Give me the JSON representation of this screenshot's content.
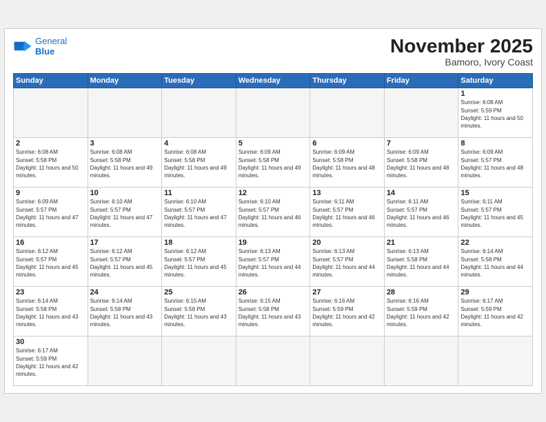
{
  "header": {
    "logo_line1": "General",
    "logo_line2": "Blue",
    "title": "November 2025",
    "subtitle": "Bamoro, Ivory Coast"
  },
  "weekdays": [
    "Sunday",
    "Monday",
    "Tuesday",
    "Wednesday",
    "Thursday",
    "Friday",
    "Saturday"
  ],
  "weeks": [
    [
      {
        "day": "",
        "empty": true
      },
      {
        "day": "",
        "empty": true
      },
      {
        "day": "",
        "empty": true
      },
      {
        "day": "",
        "empty": true
      },
      {
        "day": "",
        "empty": true
      },
      {
        "day": "",
        "empty": true
      },
      {
        "day": "1",
        "sunrise": "6:08 AM",
        "sunset": "5:59 PM",
        "daylight": "11 hours and 50 minutes."
      }
    ],
    [
      {
        "day": "2",
        "sunrise": "6:08 AM",
        "sunset": "5:58 PM",
        "daylight": "11 hours and 50 minutes."
      },
      {
        "day": "3",
        "sunrise": "6:08 AM",
        "sunset": "5:58 PM",
        "daylight": "11 hours and 49 minutes."
      },
      {
        "day": "4",
        "sunrise": "6:08 AM",
        "sunset": "5:58 PM",
        "daylight": "11 hours and 49 minutes."
      },
      {
        "day": "5",
        "sunrise": "6:09 AM",
        "sunset": "5:58 PM",
        "daylight": "11 hours and 49 minutes."
      },
      {
        "day": "6",
        "sunrise": "6:09 AM",
        "sunset": "5:58 PM",
        "daylight": "11 hours and 48 minutes."
      },
      {
        "day": "7",
        "sunrise": "6:09 AM",
        "sunset": "5:58 PM",
        "daylight": "11 hours and 48 minutes."
      },
      {
        "day": "8",
        "sunrise": "6:09 AM",
        "sunset": "5:57 PM",
        "daylight": "11 hours and 48 minutes."
      }
    ],
    [
      {
        "day": "9",
        "sunrise": "6:09 AM",
        "sunset": "5:57 PM",
        "daylight": "11 hours and 47 minutes."
      },
      {
        "day": "10",
        "sunrise": "6:10 AM",
        "sunset": "5:57 PM",
        "daylight": "11 hours and 47 minutes."
      },
      {
        "day": "11",
        "sunrise": "6:10 AM",
        "sunset": "5:57 PM",
        "daylight": "11 hours and 47 minutes."
      },
      {
        "day": "12",
        "sunrise": "6:10 AM",
        "sunset": "5:57 PM",
        "daylight": "11 hours and 46 minutes."
      },
      {
        "day": "13",
        "sunrise": "6:11 AM",
        "sunset": "5:57 PM",
        "daylight": "11 hours and 46 minutes."
      },
      {
        "day": "14",
        "sunrise": "6:11 AM",
        "sunset": "5:57 PM",
        "daylight": "11 hours and 46 minutes."
      },
      {
        "day": "15",
        "sunrise": "6:11 AM",
        "sunset": "5:57 PM",
        "daylight": "11 hours and 45 minutes."
      }
    ],
    [
      {
        "day": "16",
        "sunrise": "6:12 AM",
        "sunset": "5:57 PM",
        "daylight": "11 hours and 45 minutes."
      },
      {
        "day": "17",
        "sunrise": "6:12 AM",
        "sunset": "5:57 PM",
        "daylight": "11 hours and 45 minutes."
      },
      {
        "day": "18",
        "sunrise": "6:12 AM",
        "sunset": "5:57 PM",
        "daylight": "11 hours and 45 minutes."
      },
      {
        "day": "19",
        "sunrise": "6:13 AM",
        "sunset": "5:57 PM",
        "daylight": "11 hours and 44 minutes."
      },
      {
        "day": "20",
        "sunrise": "6:13 AM",
        "sunset": "5:57 PM",
        "daylight": "11 hours and 44 minutes."
      },
      {
        "day": "21",
        "sunrise": "6:13 AM",
        "sunset": "5:58 PM",
        "daylight": "11 hours and 44 minutes."
      },
      {
        "day": "22",
        "sunrise": "6:14 AM",
        "sunset": "5:58 PM",
        "daylight": "11 hours and 44 minutes."
      }
    ],
    [
      {
        "day": "23",
        "sunrise": "6:14 AM",
        "sunset": "5:58 PM",
        "daylight": "11 hours and 43 minutes."
      },
      {
        "day": "24",
        "sunrise": "6:14 AM",
        "sunset": "5:58 PM",
        "daylight": "11 hours and 43 minutes."
      },
      {
        "day": "25",
        "sunrise": "6:15 AM",
        "sunset": "5:58 PM",
        "daylight": "11 hours and 43 minutes."
      },
      {
        "day": "26",
        "sunrise": "6:15 AM",
        "sunset": "5:58 PM",
        "daylight": "11 hours and 43 minutes."
      },
      {
        "day": "27",
        "sunrise": "6:16 AM",
        "sunset": "5:59 PM",
        "daylight": "11 hours and 42 minutes."
      },
      {
        "day": "28",
        "sunrise": "6:16 AM",
        "sunset": "5:59 PM",
        "daylight": "11 hours and 42 minutes."
      },
      {
        "day": "29",
        "sunrise": "6:17 AM",
        "sunset": "5:59 PM",
        "daylight": "11 hours and 42 minutes."
      }
    ],
    [
      {
        "day": "30",
        "sunrise": "6:17 AM",
        "sunset": "5:59 PM",
        "daylight": "11 hours and 42 minutes."
      },
      {
        "day": "",
        "empty": true
      },
      {
        "day": "",
        "empty": true
      },
      {
        "day": "",
        "empty": true
      },
      {
        "day": "",
        "empty": true
      },
      {
        "day": "",
        "empty": true
      },
      {
        "day": "",
        "empty": true
      }
    ]
  ]
}
